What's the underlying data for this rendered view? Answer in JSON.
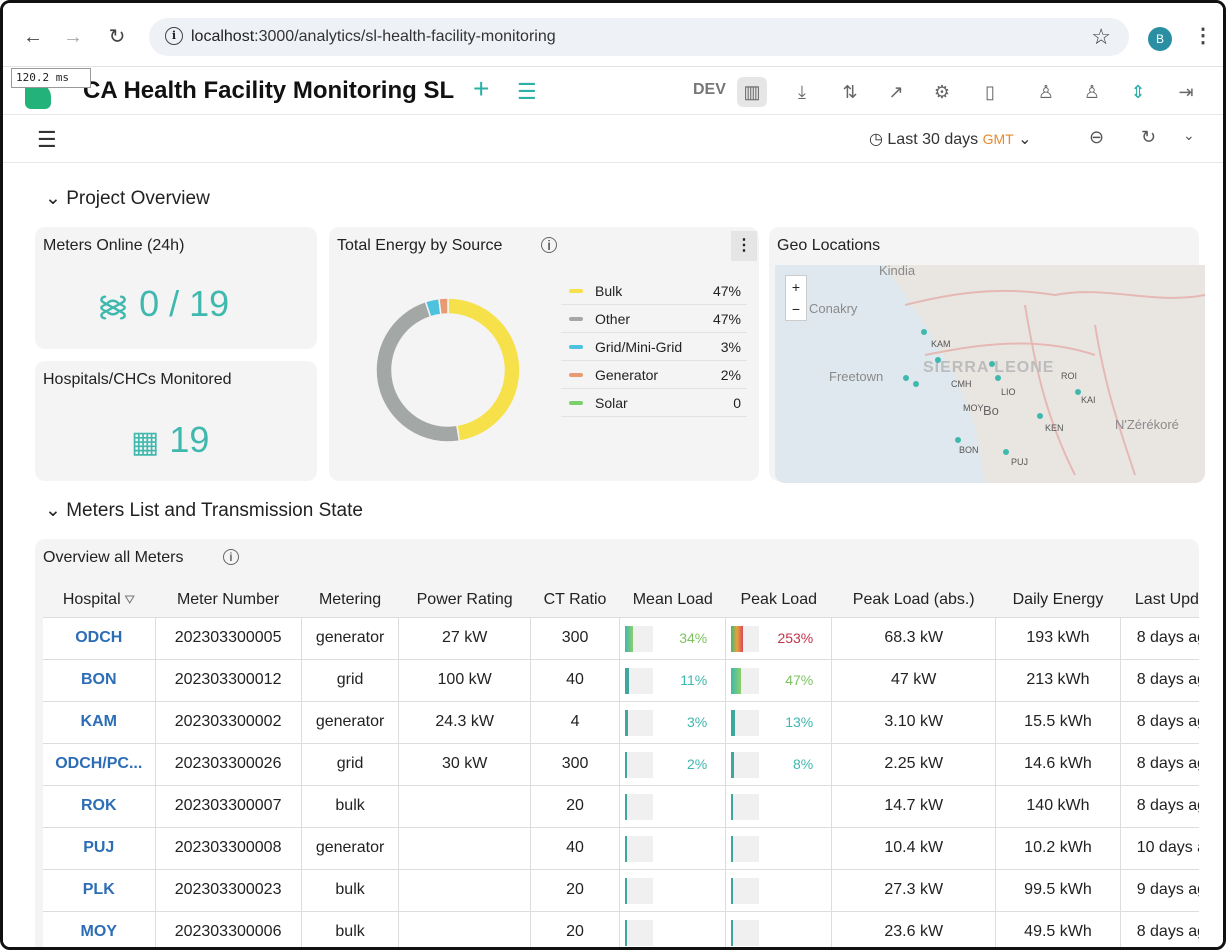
{
  "browser": {
    "url_host": "localhost",
    "url_path": ":3000/analytics/sl-health-facility-monitoring",
    "avatar": "B",
    "timing": "120.2 ms"
  },
  "app": {
    "title": "CA Health Facility Monitoring SL",
    "env": "DEV"
  },
  "time": {
    "range": "Last 30 days",
    "tz": "GMT"
  },
  "sections": {
    "overview": "Project Overview",
    "meters": "Meters List and Transmission State"
  },
  "meters_online": {
    "title": "Meters Online (24h)",
    "value": "0 / 19"
  },
  "hospitals": {
    "title": "Hospitals/CHCs Monitored",
    "value": "19"
  },
  "energy": {
    "title": "Total Energy by Source",
    "legend": [
      {
        "name": "Bulk",
        "pct": "47%",
        "color": "#f7e14b"
      },
      {
        "name": "Other",
        "pct": "47%",
        "color": "#a3a8a6"
      },
      {
        "name": "Grid/Mini-Grid",
        "pct": "3%",
        "color": "#4cc2df"
      },
      {
        "name": "Generator",
        "pct": "2%",
        "color": "#e89a73"
      },
      {
        "name": "Solar",
        "pct": "0",
        "color": "#7cd06b"
      }
    ]
  },
  "chart_data": {
    "type": "pie",
    "title": "Total Energy by Source",
    "categories": [
      "Bulk",
      "Other",
      "Grid/Mini-Grid",
      "Generator",
      "Solar"
    ],
    "values": [
      47,
      47,
      3,
      2,
      0
    ]
  },
  "geo": {
    "title": "Geo Locations",
    "labels": [
      "Kindia",
      "Conakry",
      "Freetown",
      "SIERRA LEONE",
      "Bo",
      "N'Zérékoré"
    ],
    "small": [
      "KAM",
      "CMH",
      "LIO",
      "MOY",
      "KEN",
      "BON",
      "PUJ",
      "KAI",
      "ROI"
    ]
  },
  "table": {
    "title": "Overview all Meters",
    "headers": [
      "Hospital",
      "Meter Number",
      "Metering",
      "Power Rating",
      "CT Ratio",
      "Mean Load",
      "Peak Load",
      "Peak Load (abs.)",
      "Daily Energy",
      "Last Upda"
    ],
    "rows": [
      {
        "hospital": "ODCH",
        "meter": "202303300005",
        "metering": "generator",
        "power": "27 kW",
        "ct": "300",
        "mean": "34%",
        "mean_v": 0.34,
        "peak": "253%",
        "peak_v": 1.0,
        "peak_abs": "68.3 kW",
        "daily": "193 kWh",
        "last": "8 days ag"
      },
      {
        "hospital": "BON",
        "meter": "202303300012",
        "metering": "grid",
        "power": "100 kW",
        "ct": "40",
        "mean": "11%",
        "mean_v": 0.11,
        "peak": "47%",
        "peak_v": 0.47,
        "peak_abs": "47 kW",
        "daily": "213 kWh",
        "last": "8 days ag"
      },
      {
        "hospital": "KAM",
        "meter": "202303300002",
        "metering": "generator",
        "power": "24.3 kW",
        "ct": "4",
        "mean": "3%",
        "mean_v": 0.03,
        "peak": "13%",
        "peak_v": 0.13,
        "peak_abs": "3.10 kW",
        "daily": "15.5 kWh",
        "last": "8 days ag"
      },
      {
        "hospital": "ODCH/PC...",
        "meter": "202303300026",
        "metering": "grid",
        "power": "30 kW",
        "ct": "300",
        "mean": "2%",
        "mean_v": 0.02,
        "peak": "8%",
        "peak_v": 0.08,
        "peak_abs": "2.25 kW",
        "daily": "14.6 kWh",
        "last": "8 days ag"
      },
      {
        "hospital": "ROK",
        "meter": "202303300007",
        "metering": "bulk",
        "power": "",
        "ct": "20",
        "mean": "",
        "mean_v": 0,
        "peak": "",
        "peak_v": 0,
        "peak_abs": "14.7 kW",
        "daily": "140 kWh",
        "last": "8 days ag"
      },
      {
        "hospital": "PUJ",
        "meter": "202303300008",
        "metering": "generator",
        "power": "",
        "ct": "40",
        "mean": "",
        "mean_v": 0,
        "peak": "",
        "peak_v": 0,
        "peak_abs": "10.4 kW",
        "daily": "10.2 kWh",
        "last": "10 days a"
      },
      {
        "hospital": "PLK",
        "meter": "202303300023",
        "metering": "bulk",
        "power": "",
        "ct": "20",
        "mean": "",
        "mean_v": 0,
        "peak": "",
        "peak_v": 0,
        "peak_abs": "27.3 kW",
        "daily": "99.5 kWh",
        "last": "9 days ag"
      },
      {
        "hospital": "MOY",
        "meter": "202303300006",
        "metering": "bulk",
        "power": "",
        "ct": "20",
        "mean": "",
        "mean_v": 0,
        "peak": "",
        "peak_v": 0,
        "peak_abs": "23.6 kW",
        "daily": "49.5 kWh",
        "last": "8 days ag"
      }
    ]
  }
}
